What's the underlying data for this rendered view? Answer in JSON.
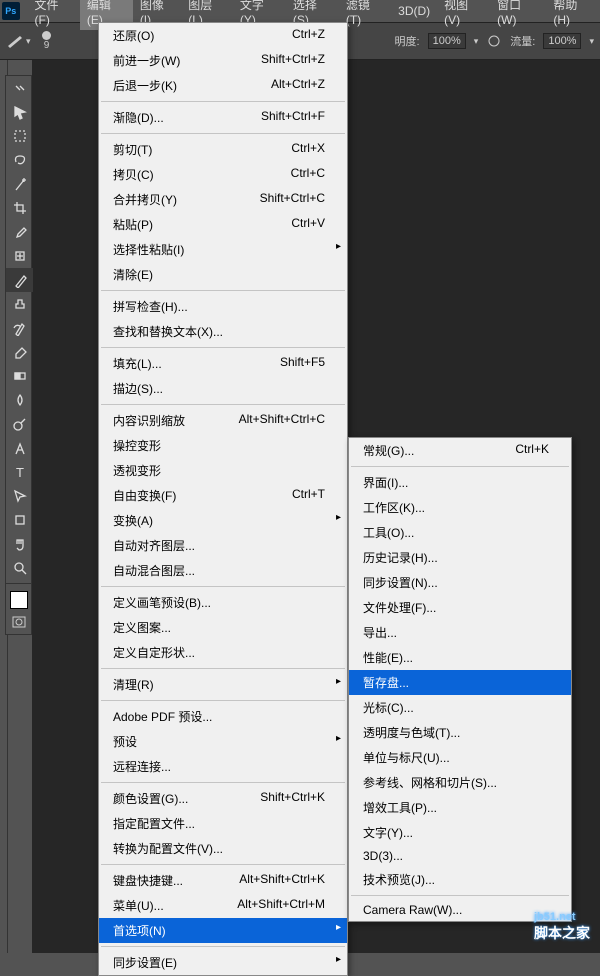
{
  "app": {
    "logo": "Ps"
  },
  "menubar": [
    {
      "label": "文件(F)"
    },
    {
      "label": "编辑(E)",
      "active": true
    },
    {
      "label": "图像(I)"
    },
    {
      "label": "图层(L)"
    },
    {
      "label": "文字(Y)"
    },
    {
      "label": "选择(S)"
    },
    {
      "label": "滤镜(T)"
    },
    {
      "label": "3D(D)"
    },
    {
      "label": "视图(V)"
    },
    {
      "label": "窗口(W)"
    },
    {
      "label": "帮助(H)"
    }
  ],
  "optbar": {
    "brush_size": "9",
    "opacity_label": "明度:",
    "opacity_val": "100%",
    "flow_label": "流量:",
    "flow_val": "100%"
  },
  "menu_edit": [
    {
      "t": "item",
      "label": "还原(O)",
      "sc": "Ctrl+Z"
    },
    {
      "t": "item",
      "label": "前进一步(W)",
      "sc": "Shift+Ctrl+Z"
    },
    {
      "t": "item",
      "label": "后退一步(K)",
      "sc": "Alt+Ctrl+Z"
    },
    {
      "t": "sep"
    },
    {
      "t": "item",
      "label": "渐隐(D)...",
      "sc": "Shift+Ctrl+F"
    },
    {
      "t": "sep"
    },
    {
      "t": "item",
      "label": "剪切(T)",
      "sc": "Ctrl+X"
    },
    {
      "t": "item",
      "label": "拷贝(C)",
      "sc": "Ctrl+C"
    },
    {
      "t": "item",
      "label": "合并拷贝(Y)",
      "sc": "Shift+Ctrl+C"
    },
    {
      "t": "item",
      "label": "粘贴(P)",
      "sc": "Ctrl+V"
    },
    {
      "t": "item",
      "label": "选择性粘贴(I)",
      "sub": true
    },
    {
      "t": "item",
      "label": "清除(E)"
    },
    {
      "t": "sep"
    },
    {
      "t": "item",
      "label": "拼写检查(H)..."
    },
    {
      "t": "item",
      "label": "查找和替换文本(X)..."
    },
    {
      "t": "sep"
    },
    {
      "t": "item",
      "label": "填充(L)...",
      "sc": "Shift+F5"
    },
    {
      "t": "item",
      "label": "描边(S)..."
    },
    {
      "t": "sep"
    },
    {
      "t": "item",
      "label": "内容识别缩放",
      "sc": "Alt+Shift+Ctrl+C"
    },
    {
      "t": "item",
      "label": "操控变形"
    },
    {
      "t": "item",
      "label": "透视变形"
    },
    {
      "t": "item",
      "label": "自由变换(F)",
      "sc": "Ctrl+T"
    },
    {
      "t": "item",
      "label": "变换(A)",
      "sub": true
    },
    {
      "t": "item",
      "label": "自动对齐图层..."
    },
    {
      "t": "item",
      "label": "自动混合图层..."
    },
    {
      "t": "sep"
    },
    {
      "t": "item",
      "label": "定义画笔预设(B)..."
    },
    {
      "t": "item",
      "label": "定义图案..."
    },
    {
      "t": "item",
      "label": "定义自定形状..."
    },
    {
      "t": "sep"
    },
    {
      "t": "item",
      "label": "清理(R)",
      "sub": true
    },
    {
      "t": "sep"
    },
    {
      "t": "item",
      "label": "Adobe PDF 预设..."
    },
    {
      "t": "item",
      "label": "预设",
      "sub": true
    },
    {
      "t": "item",
      "label": "远程连接..."
    },
    {
      "t": "sep"
    },
    {
      "t": "item",
      "label": "颜色设置(G)...",
      "sc": "Shift+Ctrl+K"
    },
    {
      "t": "item",
      "label": "指定配置文件..."
    },
    {
      "t": "item",
      "label": "转换为配置文件(V)..."
    },
    {
      "t": "sep"
    },
    {
      "t": "item",
      "label": "键盘快捷键...",
      "sc": "Alt+Shift+Ctrl+K"
    },
    {
      "t": "item",
      "label": "菜单(U)...",
      "sc": "Alt+Shift+Ctrl+M"
    },
    {
      "t": "item",
      "label": "首选项(N)",
      "sub": true,
      "hover": true
    },
    {
      "t": "sep"
    },
    {
      "t": "item",
      "label": "同步设置(E)",
      "sub": true
    }
  ],
  "menu_prefs": [
    {
      "t": "item",
      "label": "常规(G)...",
      "sc": "Ctrl+K"
    },
    {
      "t": "sep"
    },
    {
      "t": "item",
      "label": "界面(I)..."
    },
    {
      "t": "item",
      "label": "工作区(K)..."
    },
    {
      "t": "item",
      "label": "工具(O)..."
    },
    {
      "t": "item",
      "label": "历史记录(H)..."
    },
    {
      "t": "item",
      "label": "同步设置(N)..."
    },
    {
      "t": "item",
      "label": "文件处理(F)..."
    },
    {
      "t": "item",
      "label": "导出..."
    },
    {
      "t": "item",
      "label": "性能(E)..."
    },
    {
      "t": "item",
      "label": "暂存盘...",
      "hover": true
    },
    {
      "t": "item",
      "label": "光标(C)..."
    },
    {
      "t": "item",
      "label": "透明度与色域(T)..."
    },
    {
      "t": "item",
      "label": "单位与标尺(U)..."
    },
    {
      "t": "item",
      "label": "参考线、网格和切片(S)..."
    },
    {
      "t": "item",
      "label": "增效工具(P)..."
    },
    {
      "t": "item",
      "label": "文字(Y)..."
    },
    {
      "t": "item",
      "label": "3D(3)..."
    },
    {
      "t": "item",
      "label": "技术预览(J)..."
    },
    {
      "t": "sep"
    },
    {
      "t": "item",
      "label": "Camera Raw(W)..."
    }
  ],
  "watermark": {
    "url": "jb51.net",
    "text": "脚本之家"
  },
  "tools": [
    "move",
    "marquee",
    "lasso",
    "wand",
    "crop",
    "eyedropper",
    "heal",
    "brush",
    "stamp",
    "history",
    "eraser",
    "gradient",
    "blur",
    "dodge",
    "pen",
    "type",
    "path",
    "shape",
    "hand",
    "zoom"
  ]
}
